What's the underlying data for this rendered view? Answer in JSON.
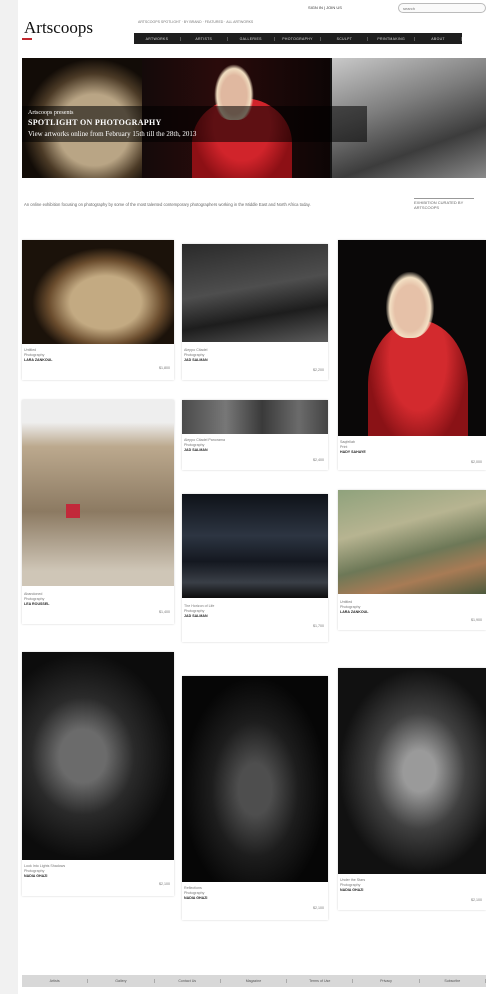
{
  "header": {
    "logo": "Artscoops",
    "signin": "SIGN IN | JOIN US",
    "search_placeholder": "search",
    "topline": "ARTSCOOPS SPOTLIGHT · BY BRAND · FEATURED · ALL ARTWORKS",
    "nav": [
      "ARTWORKS",
      "ARTISTS",
      "GALLERIES",
      "PHOTOGRAPHY",
      "SCULPT",
      "PRINTMAKING",
      "ABOUT"
    ]
  },
  "banner": {
    "pre": "Artscoops presents",
    "headline": "SPOTLIGHT ON PHOTOGRAPHY",
    "sub": "View artworks online from February 15th till the 28th, 2013"
  },
  "intro": {
    "text": "An online exhibition focusing on photography by some of the most talented contemporary photographers working in the Middle East and North Africa today.",
    "side_note": "EXHIBITION CURATED BY ARTSCOOPS"
  },
  "cards": [
    {
      "title": "Untitled",
      "medium": "Photography",
      "artist": "LARA ZANKOUL",
      "price": "$1,800"
    },
    {
      "title": "Aleppo Citadel",
      "medium": "Photography",
      "artist": "JAD SALMAN",
      "price": "$2,200"
    },
    {
      "title": "Saqfellab",
      "medium": "Print",
      "artist": "HADY SAHAYE",
      "price": "$2,000"
    },
    {
      "title": "Abandoned",
      "medium": "Photography",
      "artist": "LEA ROUSSEL",
      "price": "$1,400"
    },
    {
      "title": "Aleppo Citadel Panorama",
      "medium": "Photography",
      "artist": "JAD SALMAN",
      "price": "$2,400"
    },
    {
      "title": "The Horizon of Life",
      "medium": "Photography",
      "artist": "JAD SALMAN",
      "price": "$1,700"
    },
    {
      "title": "Untitled",
      "medium": "Photography",
      "artist": "LARA ZANKOUL",
      "price": "$1,900"
    },
    {
      "title": "Look Into Lights Shadows",
      "medium": "Photography",
      "artist": "NADIA GHAZI",
      "price": "$2,100"
    },
    {
      "title": "Reflections",
      "medium": "Photography",
      "artist": "NADIA GHAZI",
      "price": "$2,100"
    },
    {
      "title": "Under the Stars",
      "medium": "Photography",
      "artist": "NADIA GHAZI",
      "price": "$2,100"
    }
  ],
  "footer": [
    "Artists",
    "Gallery",
    "Contact Us",
    "Magazine",
    "Terms of Use",
    "Privacy",
    "Subscribe"
  ]
}
